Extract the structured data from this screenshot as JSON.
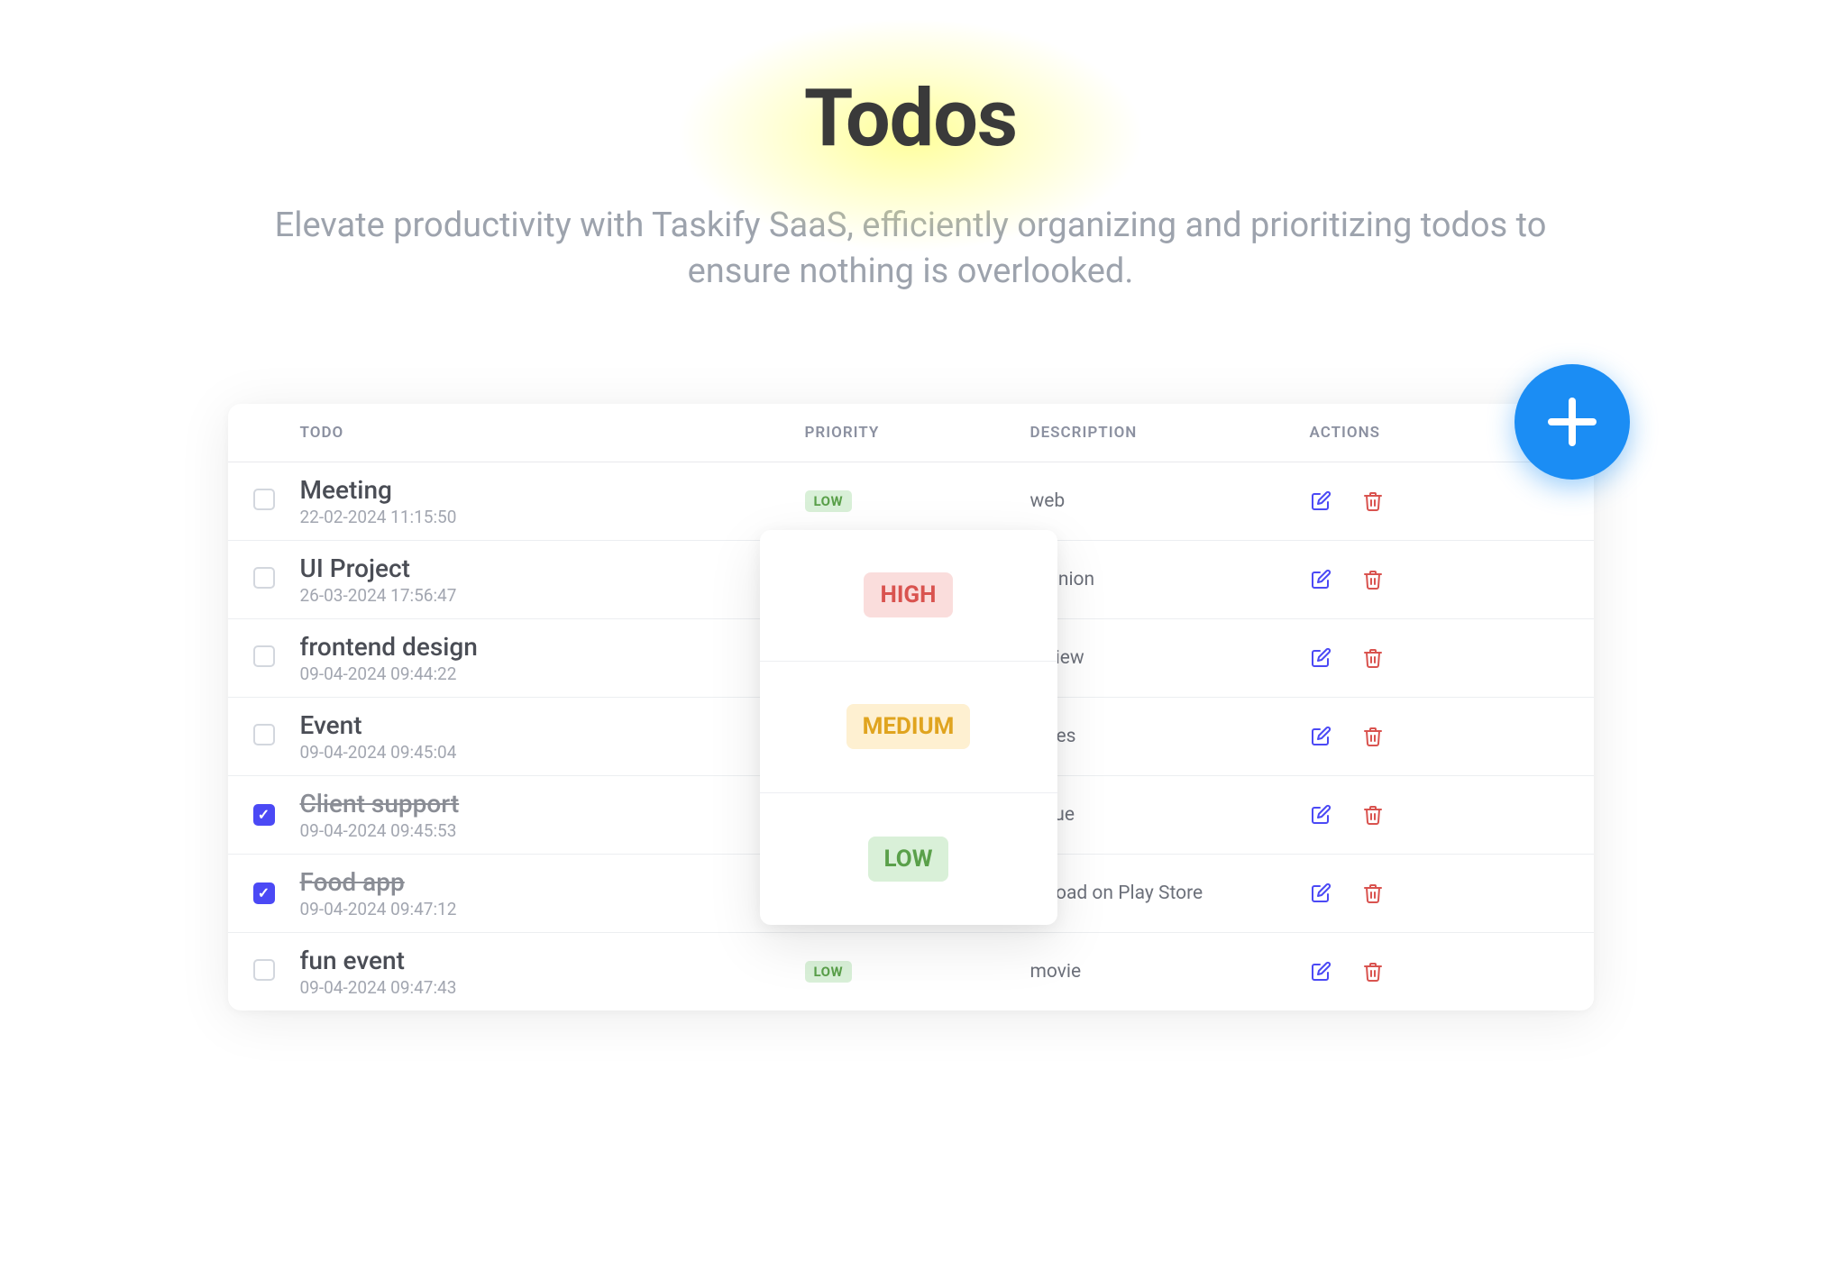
{
  "header": {
    "title": "Todos",
    "subtitle": "Elevate productivity with Taskify SaaS, efficiently organizing and prioritizing todos to ensure nothing is overlooked."
  },
  "table": {
    "headers": {
      "todo": "TODO",
      "priority": "PRIORITY",
      "description": "DESCRIPTION",
      "actions": "ACTIONS"
    },
    "rows": [
      {
        "title": "Meeting",
        "date": "22-02-2024 11:15:50",
        "priority": "LOW",
        "priority_class": "low",
        "description": "web",
        "checked": false
      },
      {
        "title": "UI Project",
        "date": "26-03-2024 17:56:47",
        "priority": "",
        "priority_class": "",
        "description": "Opinion",
        "checked": false
      },
      {
        "title": "frontend design",
        "date": "09-04-2024 09:44:22",
        "priority": "",
        "priority_class": "",
        "description": "review",
        "checked": false
      },
      {
        "title": "Event",
        "date": "09-04-2024 09:45:04",
        "priority": "",
        "priority_class": "",
        "description": "Sales",
        "checked": false
      },
      {
        "title": "Client support",
        "date": "09-04-2024 09:45:53",
        "priority": "",
        "priority_class": "",
        "description": "issue",
        "checked": true
      },
      {
        "title": "Food app",
        "date": "09-04-2024 09:47:12",
        "priority": "",
        "priority_class": "",
        "description": "upload on Play Store",
        "checked": true
      },
      {
        "title": "fun event",
        "date": "09-04-2024 09:47:43",
        "priority": "LOW",
        "priority_class": "low",
        "description": "movie",
        "checked": false
      }
    ]
  },
  "popover": {
    "options": [
      {
        "label": "HIGH",
        "class": "high"
      },
      {
        "label": "MEDIUM",
        "class": "medium"
      },
      {
        "label": "LOW",
        "class": "low"
      }
    ]
  },
  "colors": {
    "accent": "#1b8df4",
    "edit_icon": "#4b49f5",
    "delete_icon": "#d9534f"
  }
}
